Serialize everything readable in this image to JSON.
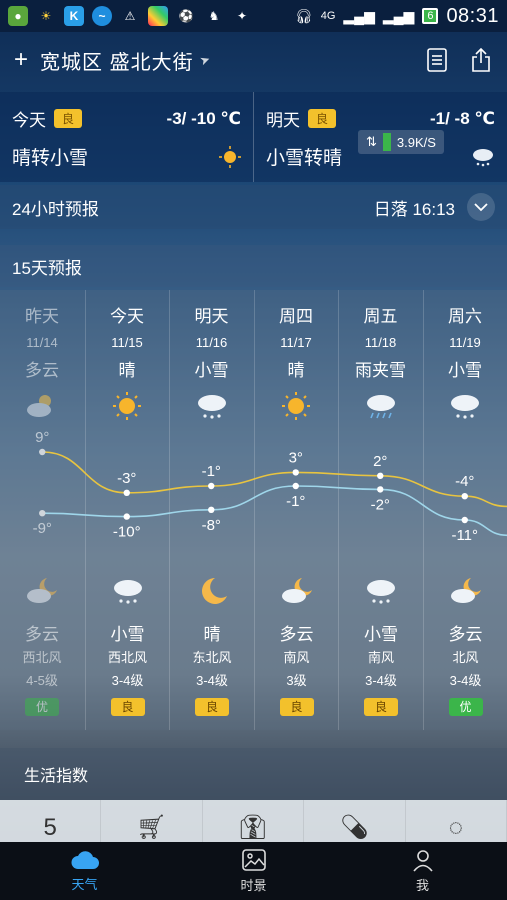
{
  "statusbar": {
    "network": "4G",
    "battery": "6",
    "time": "08:31",
    "app_icons": [
      "wechat-icon",
      "sun-icon",
      "k-icon",
      "vpn-icon",
      "warning-icon",
      "photo-icon",
      "soccer-icon",
      "helmet-icon",
      "badge-icon"
    ]
  },
  "header": {
    "add_label": "+",
    "location": "宽城区 盛北大街",
    "icons": [
      "list-icon",
      "share-icon"
    ]
  },
  "today": {
    "label": "今天",
    "aq": "良",
    "temps": "-3/ -10 ℃",
    "condition": "晴转小雪"
  },
  "tomorrow": {
    "label": "明天",
    "aq": "良",
    "temps": "-1/ -8 ℃",
    "condition": "小雪转晴",
    "speed": "3.9K/S"
  },
  "hourly": {
    "title": "24小时预报",
    "sunset": "日落 16:13"
  },
  "daily": {
    "title": "15天预报",
    "days": [
      {
        "weekday": "昨天",
        "date": "11/14",
        "day_cond": "多云",
        "day_icon": "partly-cloudy-icon",
        "high": "9°",
        "low": "-9°",
        "night_icon": "cloudy-night-icon",
        "night_cond": "多云",
        "wind": "西北风",
        "level": "4-5级",
        "aq": "优"
      },
      {
        "weekday": "今天",
        "date": "11/15",
        "day_cond": "晴",
        "day_icon": "sunny-icon",
        "high": "-3°",
        "low": "-10°",
        "night_icon": "snow-icon",
        "night_cond": "小雪",
        "wind": "西北风",
        "level": "3-4级",
        "aq": "良"
      },
      {
        "weekday": "明天",
        "date": "11/16",
        "day_cond": "小雪",
        "day_icon": "snow-icon",
        "high": "-1°",
        "low": "-8°",
        "night_icon": "moon-icon",
        "night_cond": "晴",
        "wind": "东北风",
        "level": "3-4级",
        "aq": "良"
      },
      {
        "weekday": "周四",
        "date": "11/17",
        "day_cond": "晴",
        "day_icon": "sunny-icon",
        "high": "3°",
        "low": "-1°",
        "night_icon": "cloudy-night-icon",
        "night_cond": "多云",
        "wind": "南风",
        "level": "3级",
        "aq": "良"
      },
      {
        "weekday": "周五",
        "date": "11/18",
        "day_cond": "雨夹雪",
        "day_icon": "sleet-icon",
        "high": "2°",
        "low": "-2°",
        "night_icon": "snow-icon",
        "night_cond": "小雪",
        "wind": "南风",
        "level": "3-4级",
        "aq": "良"
      },
      {
        "weekday": "周六",
        "date": "11/19",
        "day_cond": "小雪",
        "day_icon": "snow-icon",
        "high": "-4°",
        "low": "-11°",
        "night_icon": "cloudy-night-icon",
        "night_cond": "多云",
        "wind": "北风",
        "level": "3-4级",
        "aq": "优"
      }
    ]
  },
  "chart_data": {
    "type": "line",
    "x": [
      "11/14",
      "11/15",
      "11/16",
      "11/17",
      "11/18",
      "11/19"
    ],
    "series": [
      {
        "values": [
          9,
          -3,
          -1,
          3,
          2,
          -4
        ],
        "color": "#e8c440"
      },
      {
        "values": [
          -9,
          -10,
          -8,
          -1,
          -2,
          -11
        ],
        "color": "#9fd6ea"
      }
    ]
  },
  "life_index": {
    "title": "生活指数",
    "first_value": "5"
  },
  "nav": {
    "items": [
      {
        "label": "天气",
        "icon": "cloud-icon"
      },
      {
        "label": "时景",
        "icon": "photo-icon"
      },
      {
        "label": "我",
        "icon": "person-icon"
      }
    ]
  },
  "colors": {
    "accent": "#38a4f2",
    "aq_good": "#f3c12c",
    "aq_best": "#3bb54a"
  }
}
